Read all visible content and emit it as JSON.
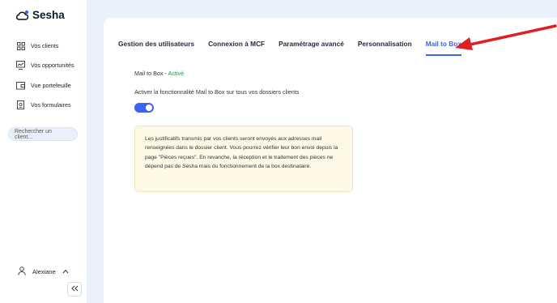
{
  "app": {
    "name": "Sesha"
  },
  "sidebar": {
    "items": [
      {
        "label": "Vos clients",
        "icon": "grid-icon"
      },
      {
        "label": "Vos opportunités",
        "icon": "chart-icon"
      },
      {
        "label": "Vue portefeuille",
        "icon": "wallet-icon"
      },
      {
        "label": "Vos formulaires",
        "icon": "form-icon"
      }
    ],
    "search_placeholder": "Rechercher un client...",
    "user_name": "Alexiane"
  },
  "tabs": [
    {
      "label": "Gestion des utilisateurs",
      "active": false
    },
    {
      "label": "Connexion à MCF",
      "active": false
    },
    {
      "label": "Paramétrage avancé",
      "active": false
    },
    {
      "label": "Personnalisation",
      "active": false
    },
    {
      "label": "Mail to Box",
      "active": true
    }
  ],
  "mailtobox": {
    "status_prefix": "Mail to Box - ",
    "status_value": "Activé",
    "option_label": "Activer la fonctionnalité Mail to Box sur tous vos dossiers clients",
    "toggle_on": true,
    "info_text": "Les justificatifs transmis par vos clients seront envoyés aux adresses mail renseignées dans le dossier client. Vous pourrez vérifier leur bon envoi depuis la page \"Pièces reçues\". En revanche, la réception et le traitement des pièces ne dépend pas de Sesha mais du fonctionnement de la box destinataire."
  },
  "colors": {
    "accent": "#3d63f1",
    "active_status": "#1a9a44",
    "annotation_arrow": "#e02020",
    "info_bg": "#fdf9e6"
  }
}
